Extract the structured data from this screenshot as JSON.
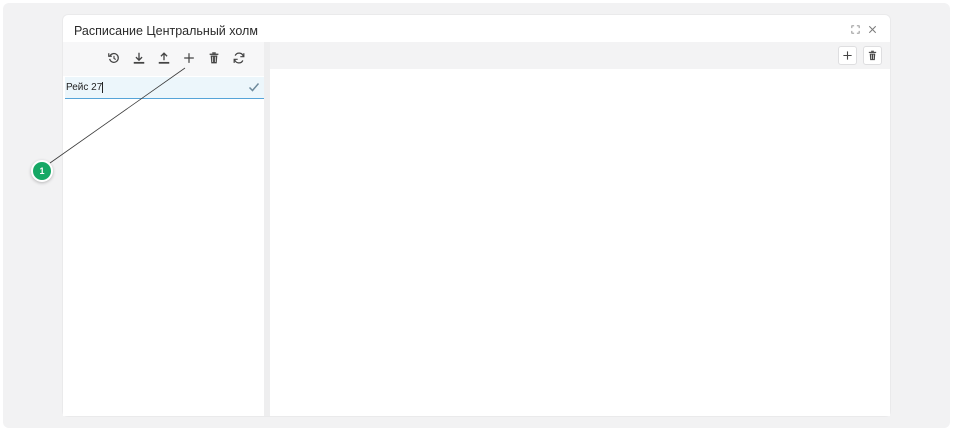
{
  "dialog": {
    "title": "Расписание Центральный холм",
    "controls": [
      "expand-icon",
      "close-icon"
    ]
  },
  "left_toolbar": {
    "buttons": [
      "history-icon",
      "download-icon",
      "upload-icon",
      "plus-icon",
      "trash-icon",
      "refresh-icon"
    ]
  },
  "edit_row": {
    "value": "Рейс 27",
    "confirm_icon": "check-icon"
  },
  "right_toolbar": {
    "buttons": [
      "plus-icon",
      "trash-icon"
    ]
  },
  "callout": {
    "number": "1",
    "color": "#16a865"
  },
  "colors": {
    "accent_underline": "#56a4d8",
    "edit_row_bg": "#ecf6fb",
    "backdrop": "#f2f2f3"
  }
}
